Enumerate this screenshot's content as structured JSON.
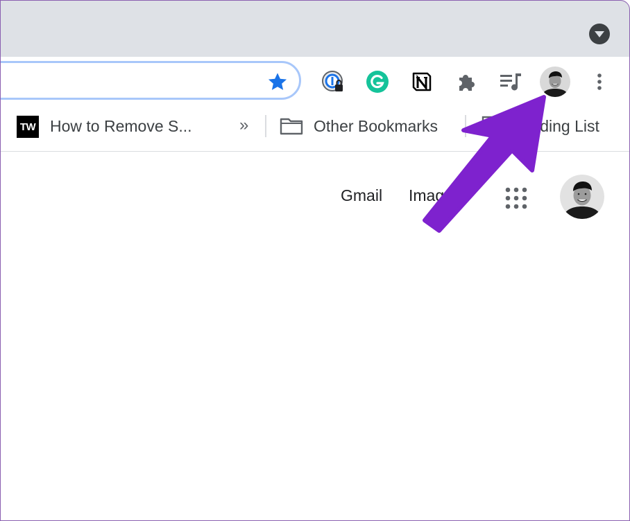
{
  "bookmarks_bar": {
    "item1_favicon_text": "TW",
    "item1_label": "How to Remove S...",
    "overflow_chevron": "»",
    "other_bookmarks_label": "Other Bookmarks",
    "reading_list_label": "Reading List"
  },
  "google_header": {
    "gmail_label": "Gmail",
    "images_label": "Images"
  },
  "icons": {
    "tab_search": "chevron-down-icon",
    "bookmark_star": "star-icon",
    "password_manager": "password-manager-icon",
    "grammarly": "grammarly-icon",
    "notion": "notion-icon",
    "extensions": "puzzle-icon",
    "media": "media-control-icon",
    "menu": "kebab-menu-icon",
    "apps": "apps-grid-icon"
  },
  "colors": {
    "tabstrip_bg": "#dee1e6",
    "omnibox_focus": "#a8c7fa",
    "star_blue": "#1a73e8",
    "grammarly_green": "#15c39a",
    "annotation_arrow": "#7e22ce"
  }
}
